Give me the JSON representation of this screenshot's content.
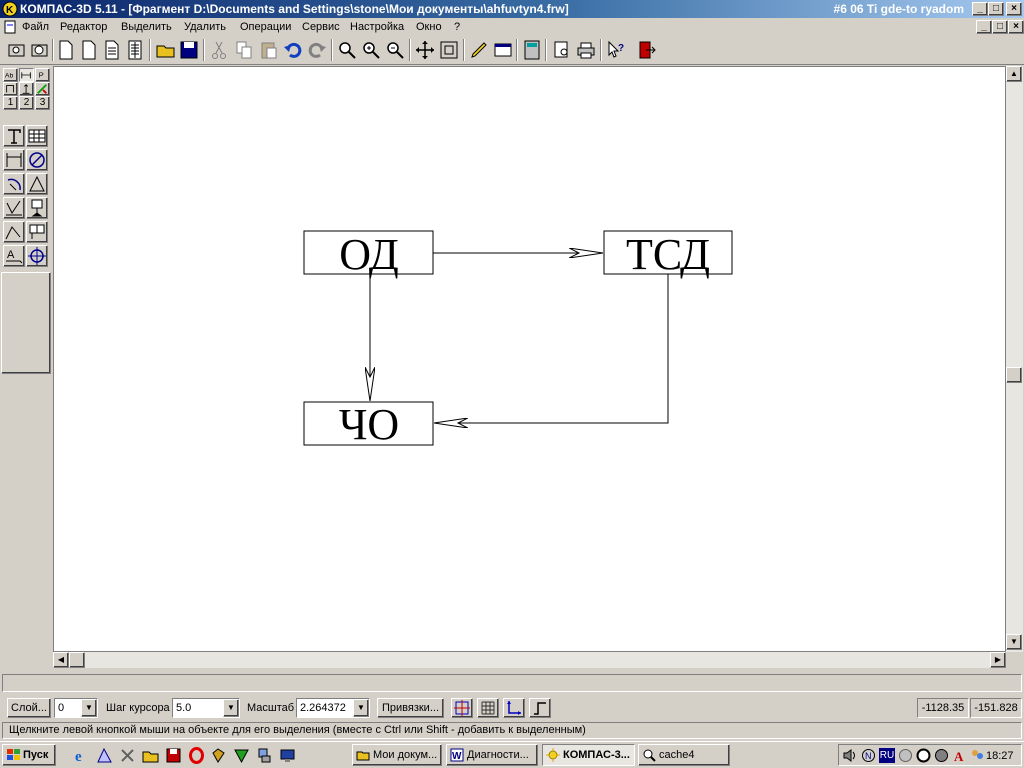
{
  "window": {
    "title": "КОМПАС-3D 5.11 - [Фрагмент D:\\Documents and Settings\\stone\\Мои документы\\ahfuvtyn4.frw]",
    "right_title": "#6 06 Ti gde-to ryadom",
    "controls": [
      "_",
      "□",
      "×"
    ]
  },
  "menu": {
    "items": [
      "Файл",
      "Редактор",
      "Выделить",
      "Удалить",
      "Операции",
      "Сервис",
      "Настройка",
      "Окно",
      "?"
    ],
    "doc_controls": [
      "_",
      "□",
      "×"
    ]
  },
  "palette": {
    "tabs": [
      "1",
      "2",
      "3"
    ]
  },
  "diagram": {
    "nodes": [
      "ОД",
      "ТСД",
      "ЧО"
    ]
  },
  "statusbar": {
    "layer_button": "Слой...",
    "layer_value": "0",
    "step_label": "Шаг курсора",
    "step_value": "5.0",
    "scale_label": "Масштаб",
    "scale_value": "2.264372",
    "snap_button": "Привязки...",
    "coord_x": "-1128.35",
    "coord_y": "-151.828",
    "hint": "Щелкните левой кнопкой мыши на объекте для его выделения (вместе с Ctrl или Shift - добавить к выделенным)"
  },
  "taskbar": {
    "start": "Пуск",
    "tasks": [
      "Мои докум...",
      "Диагности...",
      "КОМПАС-3...",
      "cache4"
    ],
    "lang": "RU",
    "time": "18:27"
  },
  "colors": {
    "titlebar_start": "#0a246a",
    "titlebar_end": "#a6caf0",
    "face": "#d4d0c8",
    "canvas": "#ffffff"
  }
}
